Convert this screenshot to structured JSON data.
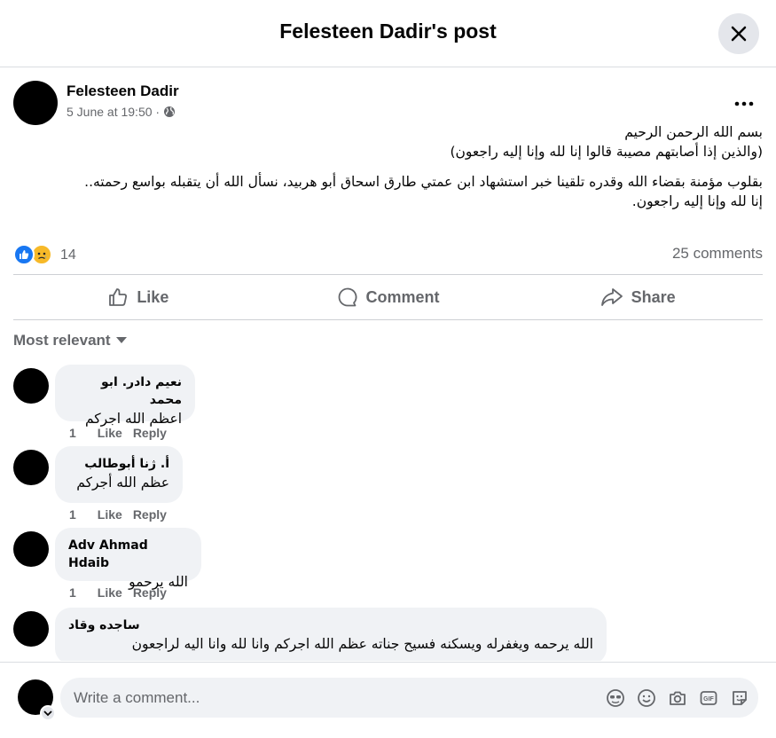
{
  "dialog": {
    "title": "Felesteen Dadir's post"
  },
  "post": {
    "author": "Felesteen Dadir",
    "timestamp": "5 June at 19:50 ·",
    "privacy_icon": "globe-icon",
    "body": {
      "line1": "بسم الله الرحمن الرحيم",
      "line2": "(والذين إذا أصابتهم مصيبة قالوا إنا لله وإنا إليه راجعون)",
      "paragraph": "بقلوب مؤمنة بقضاء الله وقدره تلقينا خبر استشهاد ابن عمتي طارق اسحاق أبو هربيد، نسأل الله أن يتقبله بواسع رحمته..",
      "closing": "إنا لله وإنا إليه راجعون."
    },
    "reactions": {
      "count": "14",
      "types": [
        "like",
        "sad"
      ]
    },
    "comments_count": "25 comments"
  },
  "actions": {
    "like": "Like",
    "comment": "Comment",
    "share": "Share"
  },
  "comments_section": {
    "sort_label": "Most relevant",
    "items": [
      {
        "author": "نعيم دادر. ابو محمد",
        "text": "اعظم الله اجركم",
        "likes": "1",
        "like_label": "Like",
        "reply_label": "Reply"
      },
      {
        "author": "أ. ژنا أبوطالب",
        "text": "عظم الله أجركم",
        "likes": "1",
        "like_label": "Like",
        "reply_label": "Reply"
      },
      {
        "author": "Adv Ahmad Hdaib",
        "text": "الله يرحمو",
        "likes": "1",
        "like_label": "Like",
        "reply_label": "Reply"
      },
      {
        "author": "ساجده وقاد",
        "text": "الله يرحمه ويغفرله ويسكنه فسيح جناته عظم الله اجركم وانا لله وانا اليه لراجعون"
      }
    ]
  },
  "composer": {
    "placeholder": "Write a comment...",
    "tools": [
      "avatar-sticker-icon",
      "emoji-icon",
      "camera-icon",
      "gif-icon",
      "sticker-icon"
    ]
  },
  "colors": {
    "accent": "#1877f2",
    "secondary_text": "#65676b",
    "bubble": "#f0f2f5",
    "sad": "#f7b928"
  }
}
